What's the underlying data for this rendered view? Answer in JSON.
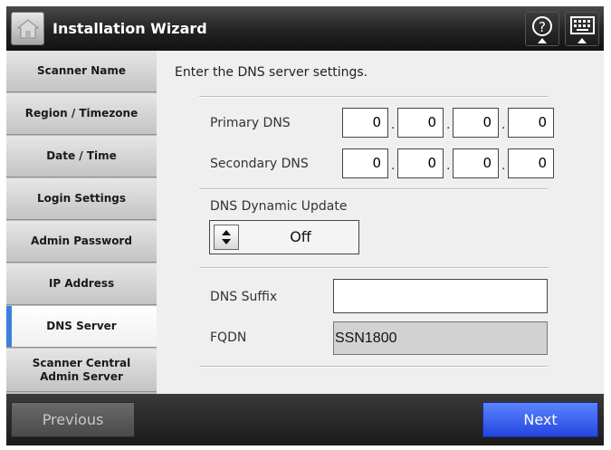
{
  "header": {
    "title": "Installation Wizard",
    "home_icon": "home-icon",
    "help_icon": "question-mark-icon",
    "keyboard_icon": "keyboard-icon"
  },
  "sidebar": {
    "items": [
      {
        "label": "Scanner Name",
        "active": false
      },
      {
        "label": "Region / Timezone",
        "active": false
      },
      {
        "label": "Date / Time",
        "active": false
      },
      {
        "label": "Login Settings",
        "active": false
      },
      {
        "label": "Admin Password",
        "active": false
      },
      {
        "label": "IP Address",
        "active": false
      },
      {
        "label": "DNS Server",
        "active": true
      },
      {
        "label": "Scanner Central Admin Server",
        "active": false
      }
    ]
  },
  "main": {
    "intro": "Enter the DNS server settings.",
    "primary_dns": {
      "label": "Primary DNS",
      "octets": [
        "0",
        "0",
        "0",
        "0"
      ]
    },
    "secondary_dns": {
      "label": "Secondary DNS",
      "octets": [
        "0",
        "0",
        "0",
        "0"
      ]
    },
    "dns_dynamic_update": {
      "label": "DNS Dynamic Update",
      "value": "Off"
    },
    "dns_suffix": {
      "label": "DNS Suffix",
      "value": ""
    },
    "fqdn": {
      "label": "FQDN",
      "value": "SSN1800"
    }
  },
  "footer": {
    "previous_label": "Previous",
    "next_label": "Next"
  },
  "colors": {
    "accent_blue": "#3b7fd9",
    "next_button": "#2346e0"
  }
}
